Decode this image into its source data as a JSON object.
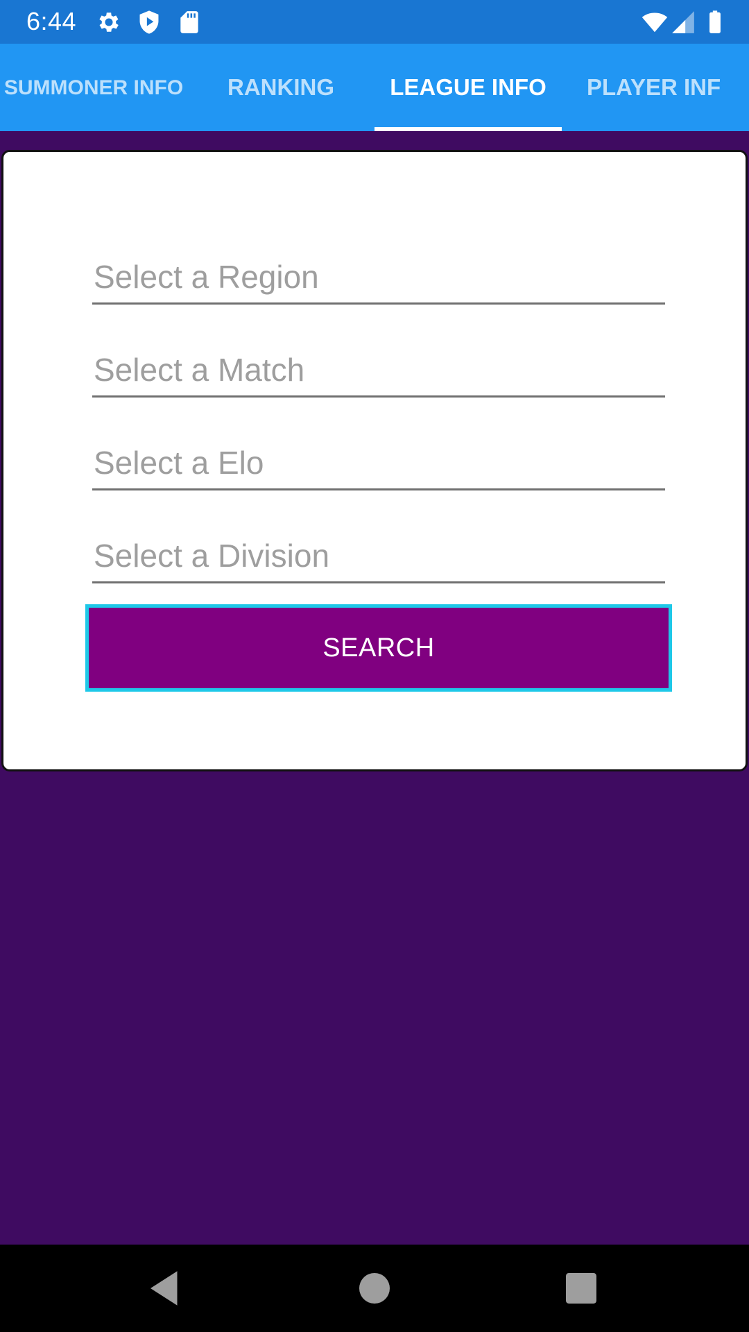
{
  "status_bar": {
    "time": "6:44",
    "icons": [
      "gear-icon",
      "shield-play-icon",
      "sd-card-icon",
      "wifi-icon",
      "signal-icon",
      "battery-icon"
    ]
  },
  "tabs": [
    {
      "label": "SUMMONER INFO",
      "active": false
    },
    {
      "label": "RANKING",
      "active": false
    },
    {
      "label": "LEAGUE INFO",
      "active": true
    },
    {
      "label": "PLAYER INF",
      "active": false
    }
  ],
  "form": {
    "region_placeholder": "Select a Region",
    "match_placeholder": "Select a Match",
    "elo_placeholder": "Select a Elo",
    "division_placeholder": "Select a Division",
    "search_label": "SEARCH"
  },
  "nav_bar": {
    "icons": [
      "back-icon",
      "home-icon",
      "recents-icon"
    ]
  },
  "colors": {
    "status_bar": "#1976d2",
    "tab_bar": "#2196f3",
    "background": "#3f0b61",
    "button": "#800080",
    "button_border": "#1ec8e8"
  }
}
